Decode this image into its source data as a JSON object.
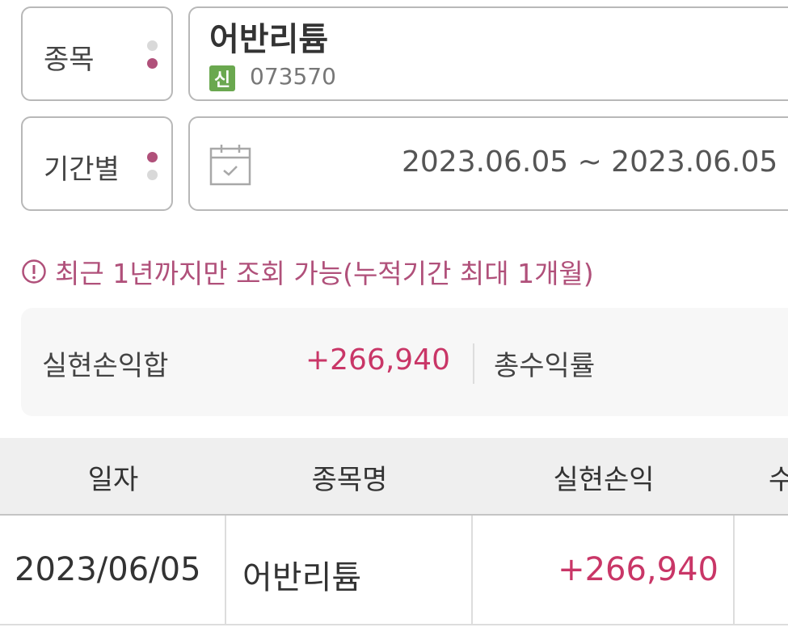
{
  "stock": {
    "label": "종목",
    "name": "어반리튬",
    "badge": "신",
    "code": "073570"
  },
  "period": {
    "label": "기간별",
    "range": "2023.06.05 ~ 2023.06.05"
  },
  "notice": "최근 1년까지만 조회 가능(누적기간 최대 1개월)",
  "summary": {
    "realized_pnl_label": "실현손익합",
    "realized_pnl_value": "+266,940",
    "total_return_label": "총수익률"
  },
  "table": {
    "headers": [
      "일자",
      "종목명",
      "실현손익",
      "수"
    ],
    "rows": [
      {
        "date": "2023/06/05",
        "name": "어반리튬",
        "pnl": "+266,940"
      }
    ]
  },
  "colors": {
    "accent": "#b0507a",
    "profit": "#c93667",
    "badge_green": "#6aa84f"
  }
}
